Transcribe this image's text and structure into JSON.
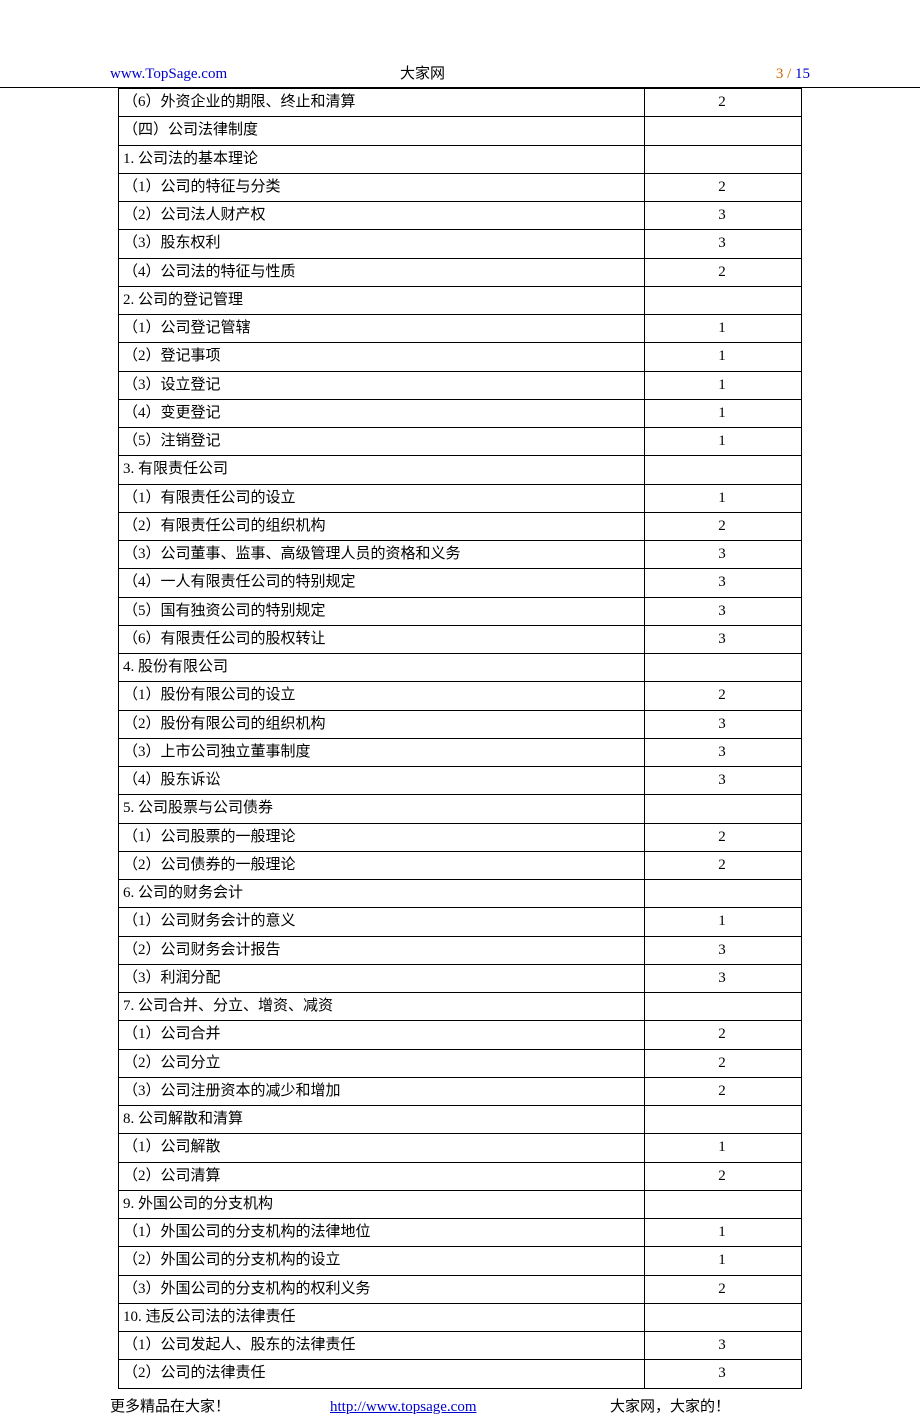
{
  "header": {
    "url": "www.TopSage.com",
    "site_name": "大家网",
    "page_current": "3",
    "page_sep": " / ",
    "page_total": "15"
  },
  "rows": [
    {
      "topic": "（6）外资企业的期限、终止和清算",
      "value": "2"
    },
    {
      "topic": "（四）公司法律制度",
      "value": ""
    },
    {
      "topic": "1. 公司法的基本理论",
      "value": ""
    },
    {
      "topic": "（1）公司的特征与分类",
      "value": "2"
    },
    {
      "topic": "（2）公司法人财产权",
      "value": "3"
    },
    {
      "topic": "（3）股东权利",
      "value": "3"
    },
    {
      "topic": "（4）公司法的特征与性质",
      "value": "2"
    },
    {
      "topic": "2. 公司的登记管理",
      "value": ""
    },
    {
      "topic": "（1）公司登记管辖",
      "value": "1"
    },
    {
      "topic": "（2）登记事项",
      "value": "1"
    },
    {
      "topic": "（3）设立登记",
      "value": "1"
    },
    {
      "topic": "（4）变更登记",
      "value": "1"
    },
    {
      "topic": "（5）注销登记",
      "value": "1"
    },
    {
      "topic": "3. 有限责任公司",
      "value": ""
    },
    {
      "topic": "（1）有限责任公司的设立",
      "value": "1"
    },
    {
      "topic": "（2）有限责任公司的组织机构",
      "value": "2"
    },
    {
      "topic": "（3）公司董事、监事、高级管理人员的资格和义务",
      "value": "3"
    },
    {
      "topic": "（4）一人有限责任公司的特别规定",
      "value": "3"
    },
    {
      "topic": "（5）国有独资公司的特别规定",
      "value": "3"
    },
    {
      "topic": "（6）有限责任公司的股权转让",
      "value": "3"
    },
    {
      "topic": "4. 股份有限公司",
      "value": ""
    },
    {
      "topic": "（1）股份有限公司的设立",
      "value": "2"
    },
    {
      "topic": "（2）股份有限公司的组织机构",
      "value": "3"
    },
    {
      "topic": "（3）上市公司独立董事制度",
      "value": "3"
    },
    {
      "topic": "（4）股东诉讼",
      "value": "3"
    },
    {
      "topic": "5. 公司股票与公司债券",
      "value": ""
    },
    {
      "topic": "（1）公司股票的一般理论",
      "value": "2"
    },
    {
      "topic": "（2）公司债券的一般理论",
      "value": "2"
    },
    {
      "topic": "6. 公司的财务会计",
      "value": ""
    },
    {
      "topic": "（1）公司财务会计的意义",
      "value": "1"
    },
    {
      "topic": "（2）公司财务会计报告",
      "value": "3"
    },
    {
      "topic": "（3）利润分配",
      "value": "3"
    },
    {
      "topic": "7. 公司合并、分立、增资、减资",
      "value": ""
    },
    {
      "topic": "（1）公司合并",
      "value": "2"
    },
    {
      "topic": "（2）公司分立",
      "value": "2"
    },
    {
      "topic": "（3）公司注册资本的减少和增加",
      "value": "2"
    },
    {
      "topic": "8. 公司解散和清算",
      "value": ""
    },
    {
      "topic": "（1）公司解散",
      "value": "1"
    },
    {
      "topic": "（2）公司清算",
      "value": "2"
    },
    {
      "topic": "9. 外国公司的分支机构",
      "value": ""
    },
    {
      "topic": "（1）外国公司的分支机构的法律地位",
      "value": "1"
    },
    {
      "topic": "（2）外国公司的分支机构的设立",
      "value": "1"
    },
    {
      "topic": "（3）外国公司的分支机构的权利义务",
      "value": "2"
    },
    {
      "topic": "10. 违反公司法的法律责任",
      "value": ""
    },
    {
      "topic": "（1）公司发起人、股东的法律责任",
      "value": "3"
    },
    {
      "topic": "（2）公司的法律责任",
      "value": "3"
    }
  ],
  "footer": {
    "left": "更多精品在大家！",
    "link": "http://www.topsage.com",
    "right": "大家网，大家的！"
  }
}
